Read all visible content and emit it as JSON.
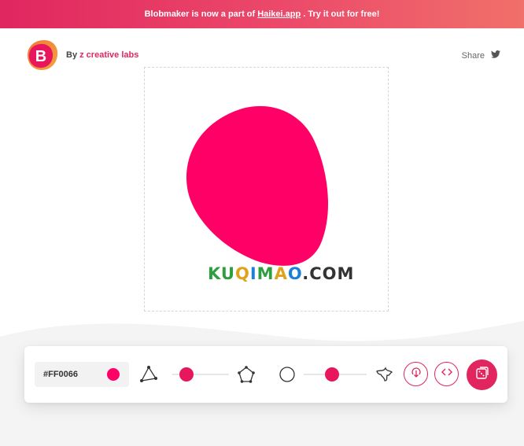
{
  "banner": {
    "text_before": "Blobmaker is now a part of",
    "link_text": "Haikei.app",
    "text_after": ". Try it out for free!"
  },
  "header": {
    "logo_letter": "B",
    "by_label": "By",
    "brand_name": "z creative labs",
    "share_label": "Share",
    "share_icon": "twitter-icon"
  },
  "blob": {
    "fill_color": "#FF0066",
    "watermark": "KUQIMAO.COM"
  },
  "toolbar": {
    "color_hex": "#FF0066",
    "complexity_min_icon": "triangle-icon",
    "complexity_max_icon": "pentagon-icon",
    "complexity_level": 0.25,
    "contrast_min_icon": "circle-icon",
    "contrast_max_icon": "spiky-shape-icon",
    "contrast_level": 0.45,
    "download_icon": "download-icon",
    "code_icon": "code-icon",
    "random_icon": "dice-icon"
  }
}
